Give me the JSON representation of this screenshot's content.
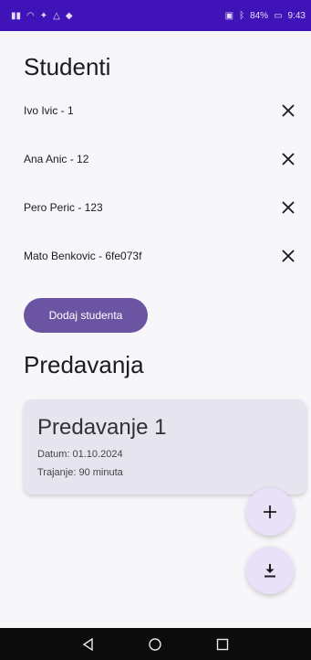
{
  "status_bar": {
    "left_icons": [
      "signal-icon",
      "wifi-icon",
      "notification-icon",
      "warning-icon",
      "app-icon"
    ],
    "battery": "84%",
    "time": "9:43"
  },
  "students": {
    "title": "Studenti",
    "items": [
      {
        "label": "Ivo Ivic - 1"
      },
      {
        "label": "Ana Anic - 12"
      },
      {
        "label": "Pero Peric - 123"
      },
      {
        "label": "Mato Benkovic - 6fe073f"
      }
    ],
    "remove_icon": "close-icon",
    "add_button_label": "Dodaj studenta"
  },
  "lectures": {
    "title": "Predavanja",
    "items": [
      {
        "title": "Predavanje 1",
        "date": "Datum: 01.10.2024",
        "duration": "Trajanje: 90 minuta"
      }
    ]
  },
  "fabs": {
    "add_icon": "plus-icon",
    "download_icon": "download-icon"
  },
  "navigation": {
    "back_icon": "back-icon",
    "home_icon": "home-icon",
    "recents_icon": "recents-icon"
  }
}
